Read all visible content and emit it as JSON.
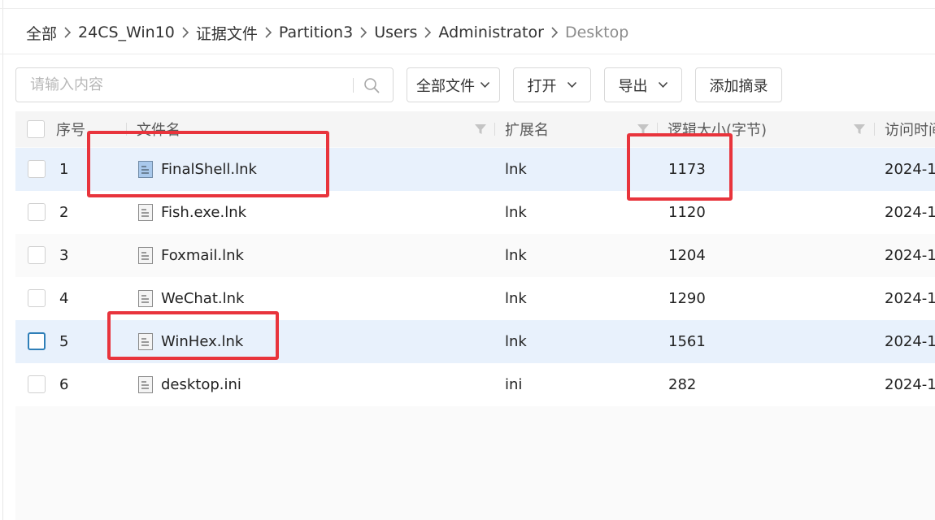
{
  "breadcrumb": {
    "items": [
      "全部",
      "24CS_Win10",
      "证据文件",
      "Partition3",
      "Users",
      "Administrator",
      "Desktop"
    ]
  },
  "toolbar": {
    "search_placeholder": "请输入内容",
    "filter_all_label": "全部文件",
    "open_label": "打开",
    "export_label": "导出",
    "add_digest_label": "添加摘录"
  },
  "table": {
    "columns": {
      "index": "序号",
      "filename": "文件名",
      "extension": "扩展名",
      "logical_size": "逻辑大小(字节)",
      "access_time": "访问时间"
    },
    "rows": [
      {
        "index": "1",
        "filename": "FinalShell.lnk",
        "extension": "lnk",
        "size": "1173",
        "access_time": "2024-1"
      },
      {
        "index": "2",
        "filename": "Fish.exe.lnk",
        "extension": "lnk",
        "size": "1120",
        "access_time": "2024-1"
      },
      {
        "index": "3",
        "filename": "Foxmail.lnk",
        "extension": "lnk",
        "size": "1204",
        "access_time": "2024-1"
      },
      {
        "index": "4",
        "filename": "WeChat.lnk",
        "extension": "lnk",
        "size": "1290",
        "access_time": "2024-1"
      },
      {
        "index": "5",
        "filename": "WinHex.lnk",
        "extension": "lnk",
        "size": "1561",
        "access_time": "2024-1"
      },
      {
        "index": "6",
        "filename": "desktop.ini",
        "extension": "ini",
        "size": "282",
        "access_time": "2024-1"
      }
    ]
  },
  "colors": {
    "annotation_red": "#e8343c",
    "row_highlight": "#e8f1fc",
    "focus_blue": "#2f7fb8"
  },
  "icons": [
    "chevron-right-icon",
    "search-icon",
    "chevron-down-icon",
    "filter-icon",
    "file-icon"
  ]
}
